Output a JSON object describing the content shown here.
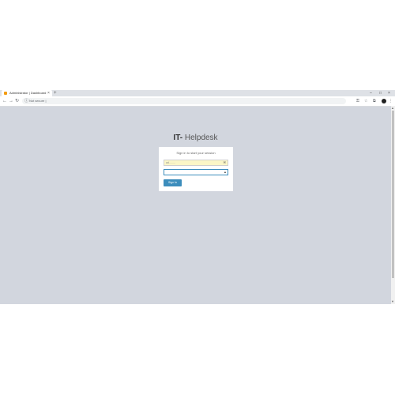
{
  "browser": {
    "tab_title": "Administrator | Dashboard",
    "tab_close": "×",
    "new_tab": "+",
    "window_controls": {
      "minimize": "–",
      "maximize": "□",
      "close": "×"
    },
    "nav": {
      "back": "←",
      "forward": "→",
      "reload": "↻"
    },
    "omnibox": {
      "info_icon": "ⓘ",
      "security_label": "Not secure",
      "separator": "|",
      "url": ""
    },
    "extensions": [
      "key-icon",
      "star-icon",
      "extension-icon",
      "profile-icon",
      "menu-icon"
    ]
  },
  "page": {
    "logo_bold": "IT-",
    "logo_rest": " Helpdesk",
    "login_message": "Sign in to start your session",
    "email_value": "ad........",
    "password_value": "",
    "signin_label": "Sign In",
    "accent_color": "#3c8dbc",
    "background_color": "#d2d6de"
  }
}
